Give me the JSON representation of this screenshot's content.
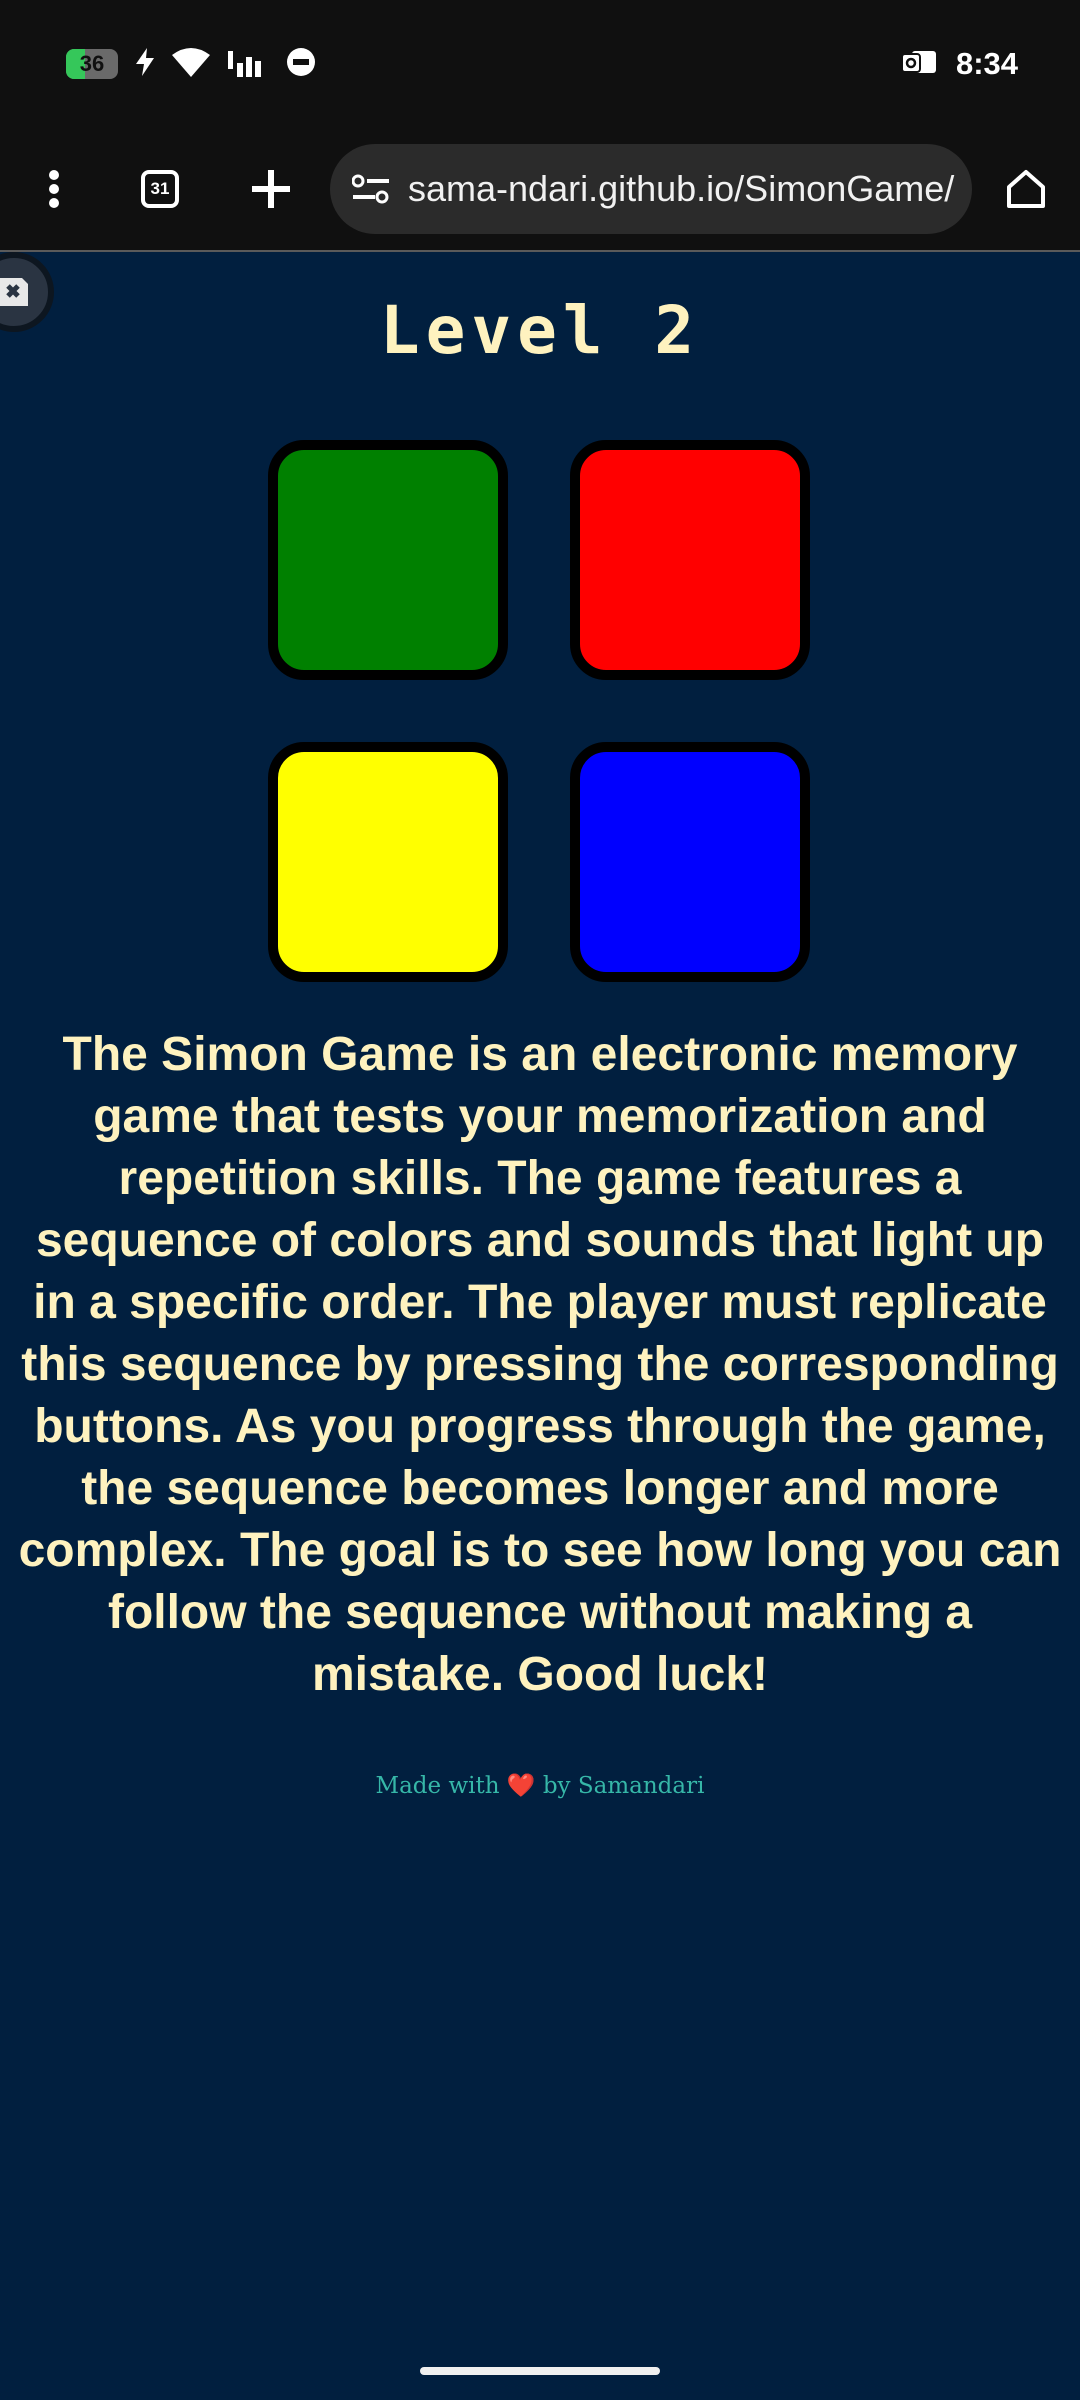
{
  "status_bar": {
    "battery": "36",
    "battery_level": 0.36,
    "charging_icon": "bolt-icon",
    "time": "8:34"
  },
  "browser": {
    "tab_count": "31",
    "url": "sama-ndari.github.io/SimonGame/"
  },
  "game": {
    "level_title": "Level 2",
    "pads": [
      {
        "color_name": "green",
        "color": "#008000"
      },
      {
        "color_name": "red",
        "color": "#ff0000"
      },
      {
        "color_name": "yellow",
        "color": "#ffff00"
      },
      {
        "color_name": "blue",
        "color": "#0000ff"
      }
    ],
    "description": "The Simon Game is an electronic memory game that tests your memorization and repetition skills. The game features a sequence of colors and sounds that light up in a specific order. The player must replicate this sequence by pressing the corresponding buttons. As you progress through the game, the sequence becomes longer and more complex. The goal is to see how long you can follow the sequence without making a mistake. Good luck!"
  },
  "footer": {
    "prefix": "Made with",
    "heart": "❤️",
    "suffix": "by Samandari"
  },
  "colors": {
    "background": "#011f3f",
    "text": "#fef2bf",
    "footer_text": "#36b7a8"
  }
}
